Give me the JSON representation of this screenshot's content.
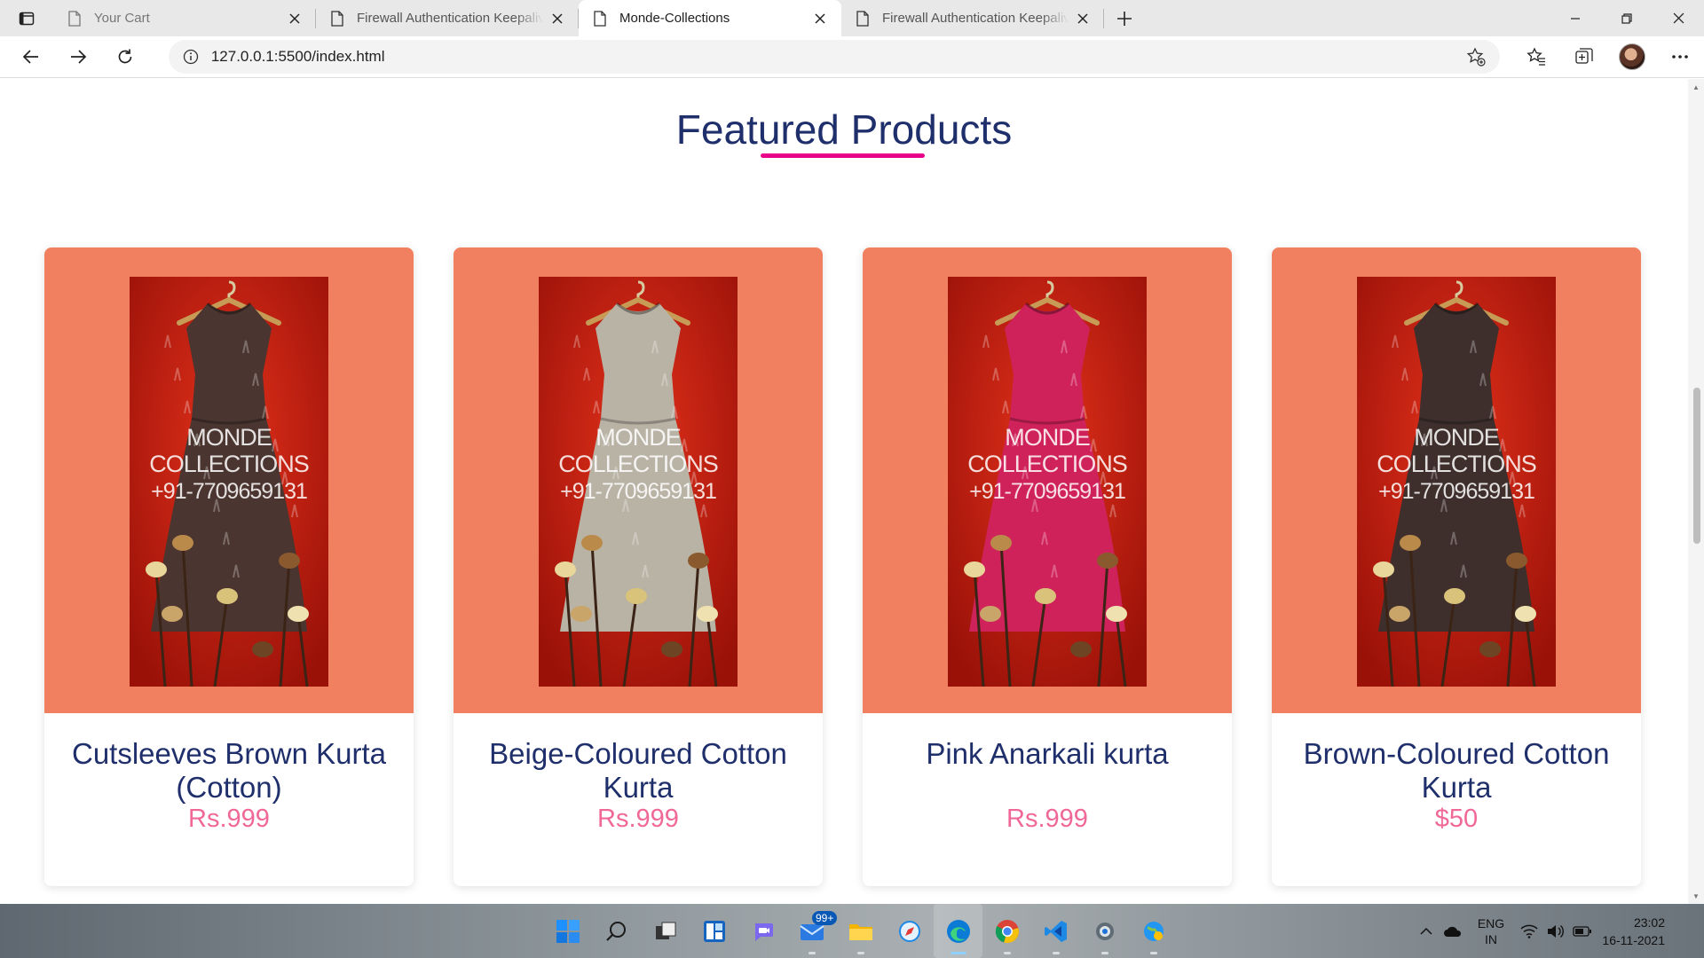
{
  "browser": {
    "tabs": [
      {
        "title": "Your Cart",
        "active": false
      },
      {
        "title": "Firewall Authentication Keepalive",
        "active": false
      },
      {
        "title": "Monde-Collections",
        "active": true
      },
      {
        "title": "Firewall Authentication Keepalive",
        "active": false
      }
    ],
    "url": "127.0.0.1:5500/index.html"
  },
  "page": {
    "section_title": "Featured Products",
    "accent_color": "#e8008a",
    "title_color": "#1f2f6b",
    "price_color": "#f06898",
    "card_bg_color": "#f0805f",
    "products": [
      {
        "name": "Cutsleeves Brown Kurta (Cotton)",
        "price": "Rs.999",
        "watermark": [
          "MONDE",
          "COLLECTIONS",
          "+91-7709659131"
        ],
        "dress_color": "#4a3530"
      },
      {
        "name": "Beige-Coloured Cotton Kurta",
        "price": "Rs.999",
        "watermark": [
          "MONDE",
          "COLLECTIONS",
          "+91-7709659131"
        ],
        "dress_color": "#b9b3a6"
      },
      {
        "name": "Pink Anarkali kurta",
        "price": "Rs.999",
        "watermark": [
          "MONDE",
          "COLLECTIONS",
          "+91-7709659131"
        ],
        "dress_color": "#d0225a"
      },
      {
        "name": "Brown-Coloured Cotton Kurta",
        "price": "$50",
        "watermark": [
          "MONDE",
          "COLLECTIONS",
          "+91-7709659131"
        ],
        "dress_color": "#3e2f2c"
      }
    ]
  },
  "taskbar": {
    "mail_badge": "99+",
    "language": "ENG",
    "region": "IN",
    "time": "23:02",
    "date": "16-11-2021"
  }
}
